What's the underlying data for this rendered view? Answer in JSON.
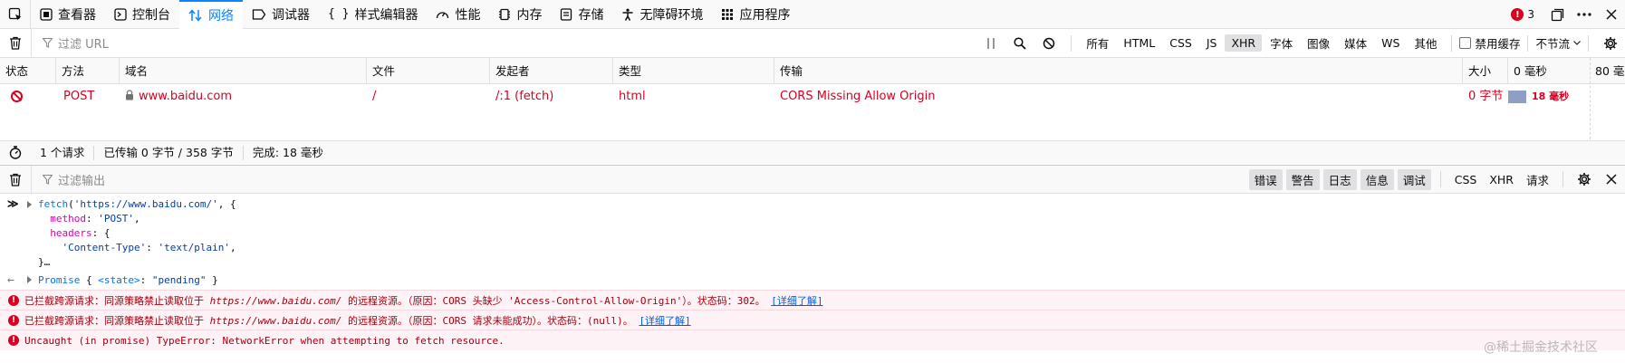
{
  "toolbar": {
    "tabs": [
      {
        "label": "查看器",
        "icon": "inspector-icon"
      },
      {
        "label": "控制台",
        "icon": "console-icon"
      },
      {
        "label": "网络",
        "icon": "network-icon",
        "active": true
      },
      {
        "label": "调试器",
        "icon": "debugger-icon"
      },
      {
        "label": "样式编辑器",
        "icon": "style-editor-icon"
      },
      {
        "label": "性能",
        "icon": "performance-icon"
      },
      {
        "label": "内存",
        "icon": "memory-icon"
      },
      {
        "label": "存储",
        "icon": "storage-icon"
      },
      {
        "label": "无障碍环境",
        "icon": "accessibility-icon"
      },
      {
        "label": "应用程序",
        "icon": "application-icon"
      }
    ],
    "error_count": "3"
  },
  "network": {
    "filter_placeholder": "过滤 URL",
    "types": [
      "所有",
      "HTML",
      "CSS",
      "JS",
      "XHR",
      "字体",
      "图像",
      "媒体",
      "WS",
      "其他"
    ],
    "selected_type": "XHR",
    "disable_cache": "禁用缓存",
    "throttle": "不节流",
    "columns": [
      "状态",
      "方法",
      "域名",
      "文件",
      "发起者",
      "类型",
      "传输",
      "大小",
      "0 毫秒",
      "80 毫"
    ],
    "row": {
      "method": "POST",
      "domain": "www.baidu.com",
      "file": "/",
      "initiator": "/:1 (fetch)",
      "type": "html",
      "transfer": "CORS Missing Allow Origin",
      "size": "0 字节",
      "timing": "18 毫秒"
    },
    "summary": {
      "requests": "1 个请求",
      "transferred": "已传输 0 字节 / 358 字节",
      "finish": "完成: 18 毫秒"
    }
  },
  "console": {
    "filter_placeholder": "过滤输出",
    "levels": [
      "错误",
      "警告",
      "日志",
      "信息",
      "调试"
    ],
    "filters": [
      "CSS",
      "XHR",
      "请求"
    ],
    "input": {
      "line1_fn": "fetch",
      "line1_url": "'https://www.baidu.com/'",
      "line2_key": "method",
      "line2_val": "'POST'",
      "line3_key": "headers",
      "line4_key": "'Content-Type'",
      "line4_val": "'text/plain'",
      "line5": "}…"
    },
    "output": {
      "promise": "Promise",
      "state_key": "<state>",
      "state_val": "\"pending\""
    },
    "errors": [
      {
        "prefix": "已拦截跨源请求：同源策略禁止读取位于 ",
        "url": "https://www.baidu.com/",
        "suffix": " 的远程资源。（原因：CORS 头缺少 'Access-Control-Allow-Origin'）。状态码：302。",
        "learn_more": "[详细了解]"
      },
      {
        "prefix": "已拦截跨源请求：同源策略禁止读取位于 ",
        "url": "https://www.baidu.com/",
        "suffix": " 的远程资源。（原因：CORS 请求未能成功）。状态码：(null)。",
        "learn_more": "[详细了解]"
      },
      {
        "text": "Uncaught (in promise) TypeError: NetworkError when attempting to fetch resource."
      }
    ],
    "watermark": "@稀土掘金技术社区"
  }
}
